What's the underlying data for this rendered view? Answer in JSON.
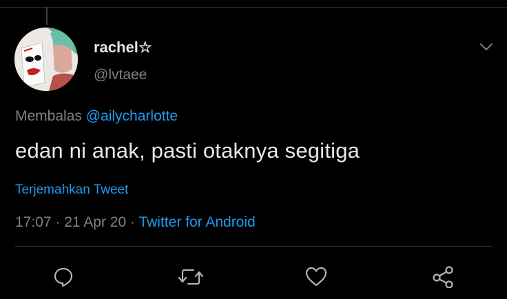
{
  "tweet": {
    "display_name": "rachel☆",
    "handle": "@lvtaee",
    "reply_prefix": "Membalas",
    "reply_to": "@ailycharlotte",
    "text": "edan ni anak, pasti otaknya segitiga",
    "translate_label": "Terjemahkan Tweet",
    "time": "17:07",
    "date": "21 Apr 20",
    "separator": "·",
    "client": "Twitter for Android"
  },
  "actions": [
    "reply-icon",
    "retweet-icon",
    "like-icon",
    "share-icon"
  ],
  "colors": {
    "background": "#000000",
    "accent": "#1d9bf0",
    "muted": "#7b8288",
    "text": "#e8e8e8"
  }
}
